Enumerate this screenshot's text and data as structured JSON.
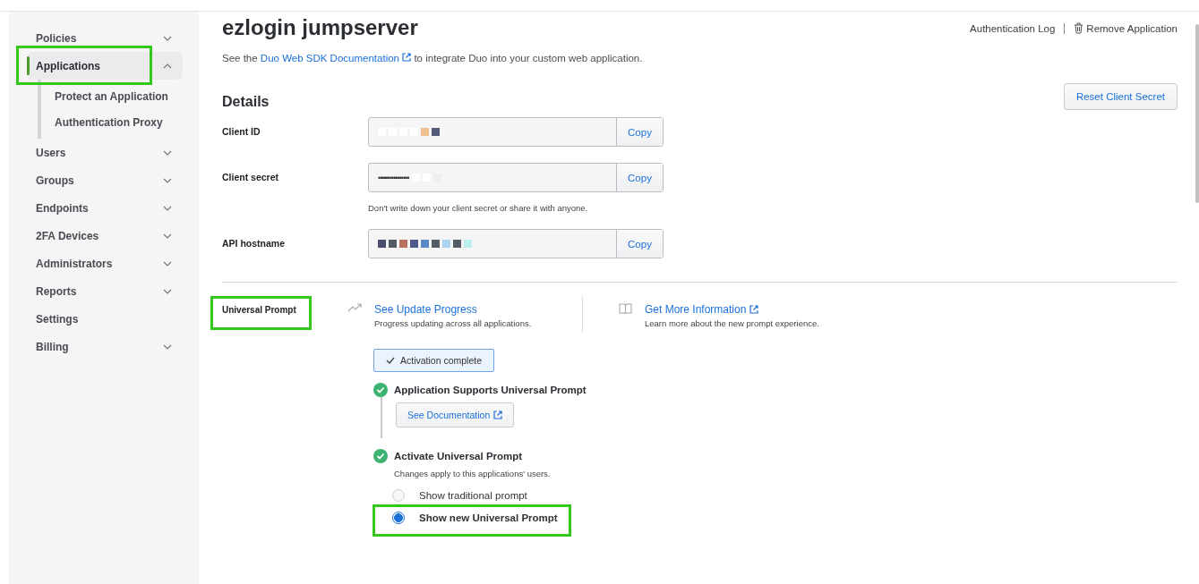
{
  "sidebar": {
    "items": [
      {
        "label": "Policies",
        "expanded": false,
        "selected": false,
        "highlighted": false
      },
      {
        "label": "Applications",
        "expanded": true,
        "selected": true,
        "highlighted": true,
        "children": [
          {
            "label": "Protect an Application"
          },
          {
            "label": "Authentication Proxy"
          }
        ]
      },
      {
        "label": "Users",
        "expanded": false,
        "selected": false,
        "highlighted": false
      },
      {
        "label": "Groups",
        "expanded": false,
        "selected": false,
        "highlighted": false
      },
      {
        "label": "Endpoints",
        "expanded": false,
        "selected": false,
        "highlighted": false
      },
      {
        "label": "2FA Devices",
        "expanded": false,
        "selected": false,
        "highlighted": false
      },
      {
        "label": "Administrators",
        "expanded": false,
        "selected": false,
        "highlighted": false
      },
      {
        "label": "Reports",
        "expanded": false,
        "selected": false,
        "highlighted": false
      },
      {
        "label": "Settings",
        "selected": false,
        "highlighted": false
      },
      {
        "label": "Billing",
        "expanded": false,
        "selected": false,
        "highlighted": false
      }
    ]
  },
  "header": {
    "title": "ezlogin jumpserver",
    "actions": [
      {
        "label": "Authentication Log",
        "kind": "link"
      },
      {
        "label": "Remove Application",
        "kind": "delete"
      }
    ],
    "intro": {
      "before": "See the",
      "link": "Duo Web SDK Documentation",
      "after": "to integrate Duo into your custom web application."
    }
  },
  "details": {
    "title": "Details",
    "reset_button": "Reset Client Secret",
    "fields": [
      {
        "label": "Client ID",
        "redacted": true,
        "button": "Copy"
      },
      {
        "label": "Client secret",
        "value": "••••••••••••••••",
        "redacted": true,
        "button": "Copy",
        "hint": "Don't write down your client secret or share it with anyone."
      },
      {
        "label": "API hostname",
        "redacted": true,
        "button": "Copy"
      }
    ]
  },
  "universal_prompt": {
    "label": "Universal Prompt",
    "highlighted": true,
    "links": [
      {
        "kind": "progress",
        "label": "See Update Progress",
        "external": false,
        "description": "Progress updating across all applications."
      },
      {
        "kind": "info",
        "label": "Get More Information",
        "external": true,
        "description": "Learn more about the new prompt experience."
      }
    ],
    "status": "Activation complete",
    "steps": [
      {
        "title": "Application Supports Universal Prompt",
        "done": true,
        "button": "See Documentation"
      },
      {
        "title": "Activate Universal Prompt",
        "done": true,
        "description": "Changes apply to this applications' users."
      }
    ],
    "options": [
      {
        "label": "Show traditional prompt",
        "selected": false,
        "highlighted": false
      },
      {
        "label": "Show new Universal Prompt",
        "selected": true,
        "highlighted": true
      }
    ]
  }
}
